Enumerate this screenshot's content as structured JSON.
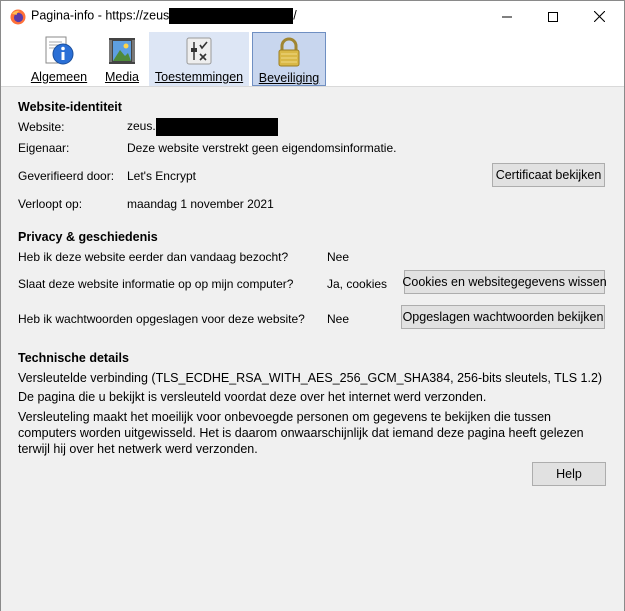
{
  "window": {
    "title_prefix": "Pagina-info - https://zeus",
    "title_suffix": "/",
    "minimize": "—",
    "maximize": "☐",
    "close": "✕"
  },
  "tabs": [
    {
      "label": "Algemeen",
      "icon": "info-icon"
    },
    {
      "label": "Media",
      "icon": "media-icon"
    },
    {
      "label": "Toestemmingen",
      "icon": "permissions-icon"
    },
    {
      "label": "Beveiliging",
      "icon": "lock-icon",
      "selected": true
    }
  ],
  "identity": {
    "heading": "Website-identiteit",
    "website_label": "Website:",
    "website_value": "zeus.",
    "owner_label": "Eigenaar:",
    "owner_value": "Deze website verstrekt geen eigendomsinformatie.",
    "verified_label": "Geverifieerd door:",
    "verified_value": "Let's Encrypt",
    "view_cert_button": "Certificaat bekijken",
    "expires_label": "Verloopt op:",
    "expires_value": "maandag 1 november 2021"
  },
  "privacy": {
    "heading": "Privacy & geschiedenis",
    "visited_q": "Heb ik deze website eerder dan vandaag bezocht?",
    "visited_a": "Nee",
    "stores_q": "Slaat deze website informatie op op mijn computer?",
    "stores_a": "Ja, cookies",
    "clear_cookies_button": "Cookies en websitegegevens wissen",
    "passwords_q": "Heb ik wachtwoorden opgeslagen voor deze website?",
    "passwords_a": "Nee",
    "view_passwords_button": "Opgeslagen wachtwoorden bekijken"
  },
  "technical": {
    "heading": "Technische details",
    "line1": "Versleutelde verbinding (TLS_ECDHE_RSA_WITH_AES_256_GCM_SHA384, 256-bits sleutels, TLS 1.2)",
    "line2": "De pagina die u bekijkt is versleuteld voordat deze over het internet werd verzonden.",
    "line3": "Versleuteling maakt het moeilijk voor onbevoegde personen om gegevens te bekijken die tussen computers worden uitgewisseld. Het is daarom onwaarschijnlijk dat iemand deze pagina heeft gelezen terwijl hij over het netwerk werd verzonden."
  },
  "help_button": "Help"
}
